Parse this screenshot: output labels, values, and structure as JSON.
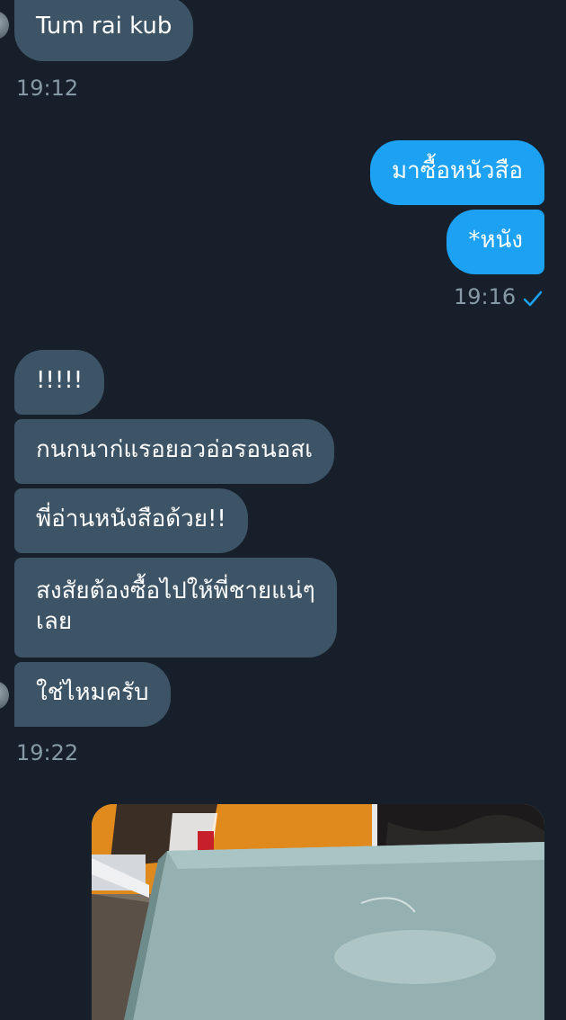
{
  "conversation": {
    "group1": {
      "messages": [
        "Tum rai kub"
      ],
      "time": "19:12"
    },
    "group2": {
      "messages": [
        "มาซื้อหนัวสือ",
        "*หนัง"
      ],
      "time": "19:16",
      "status_icon": "check-icon"
    },
    "group3": {
      "messages": [
        "!!!!!",
        "กนกนาก่แรอยอวอ่อรอนอสเ",
        "พี่อ่านหนังสือด้วย!!",
        "สงสัยต้องซื้อไปให้พี่ชายแน่ๆ",
        "เลย",
        "ใช่ไหมครับ"
      ],
      "time": "19:22"
    },
    "attachment": {
      "type": "photo"
    }
  },
  "colors": {
    "background": "#17202a",
    "incoming_bubble": "#3d5466",
    "outgoing_bubble": "#1da1f2",
    "timestamp": "#8899a6",
    "check": "#1da1f2"
  }
}
